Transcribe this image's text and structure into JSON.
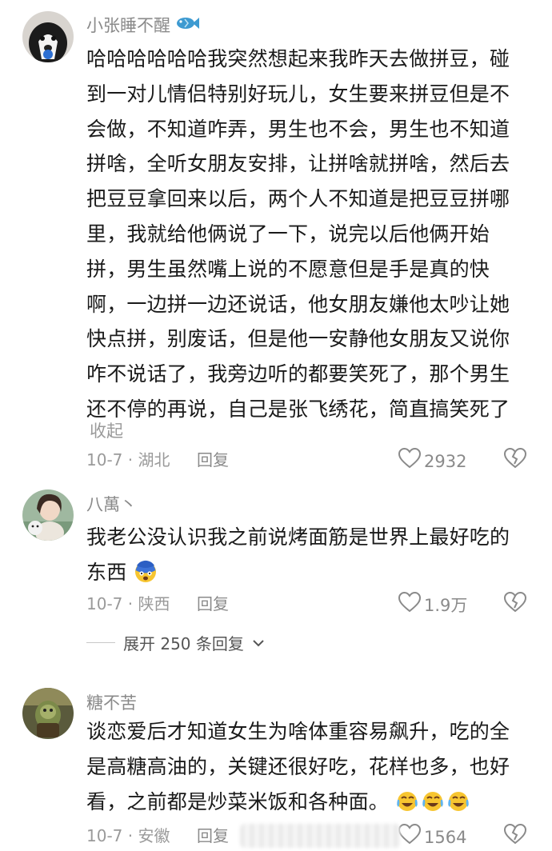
{
  "comments": [
    {
      "username": "小张睡不醒",
      "lines": [
        "哈哈哈哈哈哈我突然想起来我昨天去做拼豆，碰",
        "到一对儿情侣特别好玩儿，女生要来拼豆但是不",
        "会做，不知道咋弄，男生也不会，男生也不知道",
        "拼啥，全听女朋友安排，让拼啥就拼啥，然后去",
        "把豆豆拿回来以后，两个人不知道是把豆豆拼哪",
        "里，我就给他俩说了一下，说完以后他俩开始",
        "拼，男生虽然嘴上说的不愿意但是手是真的快",
        "啊，一边拼一边还说话，他女朋友嫌他太吵让她",
        "快点拼，别废话，但是他一安静他女朋友又说你",
        "咋不说话了，我旁边听的都要笑死了，那个男生",
        "还不停的再说，自己是张飞绣花，简直搞笑死了"
      ],
      "collapse_label": "收起",
      "date_location": "10-7 · 湖北",
      "reply_label": "回复",
      "likes": "2932"
    },
    {
      "username": "八萬丶",
      "lines": [
        "我老公没认识我之前说烤面筋是世界上最好吃的",
        "东西"
      ],
      "date_location": "10-7 · 陕西",
      "reply_label": "回复",
      "likes": "1.9万"
    },
    {
      "username": "糖不苦",
      "lines": [
        "谈恋爱后才知道女生为啥体重容易飙升，吃的全",
        "是高糖高油的，关键还很好吃，花样也多，也好",
        "看，之前都是炒菜米饭和各种面。"
      ],
      "date_location": "10-7 · 安徽",
      "reply_label": "回复",
      "likes": "1564"
    }
  ],
  "expand_replies_label": "展开 250 条回复",
  "icons": {
    "like": "heart-outline-icon",
    "dislike": "broken-heart-icon",
    "fish": "fish-icon",
    "chevron": "chevron-down-icon",
    "emoji_scared": "scared-face-emoji",
    "emoji_cry_laugh": "crying-laughing-emoji"
  },
  "colors": {
    "text": "#1a1a1a",
    "meta": "#9a9a9a",
    "fish": "#3d9ad1"
  }
}
